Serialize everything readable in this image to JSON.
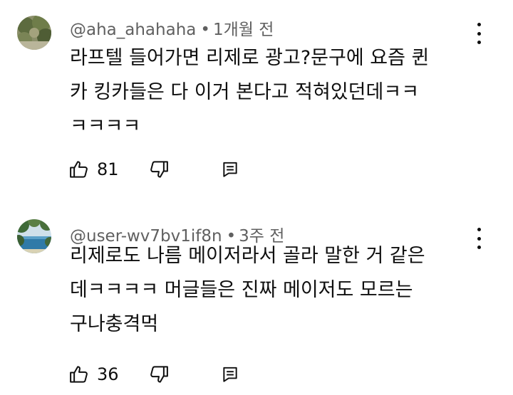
{
  "comments": [
    {
      "author": "@aha_ahahaha",
      "time": "1개월 전",
      "text": "라프텔 들어가면 리제로 광고?문구에 요즘 퀸\n카 킹카들은 다 이거 본다고 적혀있던데ㅋㅋ\nㅋㅋㅋㅋ",
      "likes": "81",
      "icons": {
        "like": "thumb-up-icon",
        "dislike": "thumb-down-icon",
        "reply": "reply-icon",
        "menu": "more-vert-icon"
      }
    },
    {
      "author": "@user-wv7bv1if8n",
      "time": "3주 전",
      "text": "리제로도 나름 메이저라서 골라 말한 거 같은\n데ㅋㅋㅋㅋ 머글들은 진짜 메이저도 모르는\n구나충격먹",
      "likes": "36",
      "icons": {
        "like": "thumb-up-icon",
        "dislike": "thumb-down-icon",
        "reply": "reply-icon",
        "menu": "more-vert-icon"
      }
    }
  ]
}
